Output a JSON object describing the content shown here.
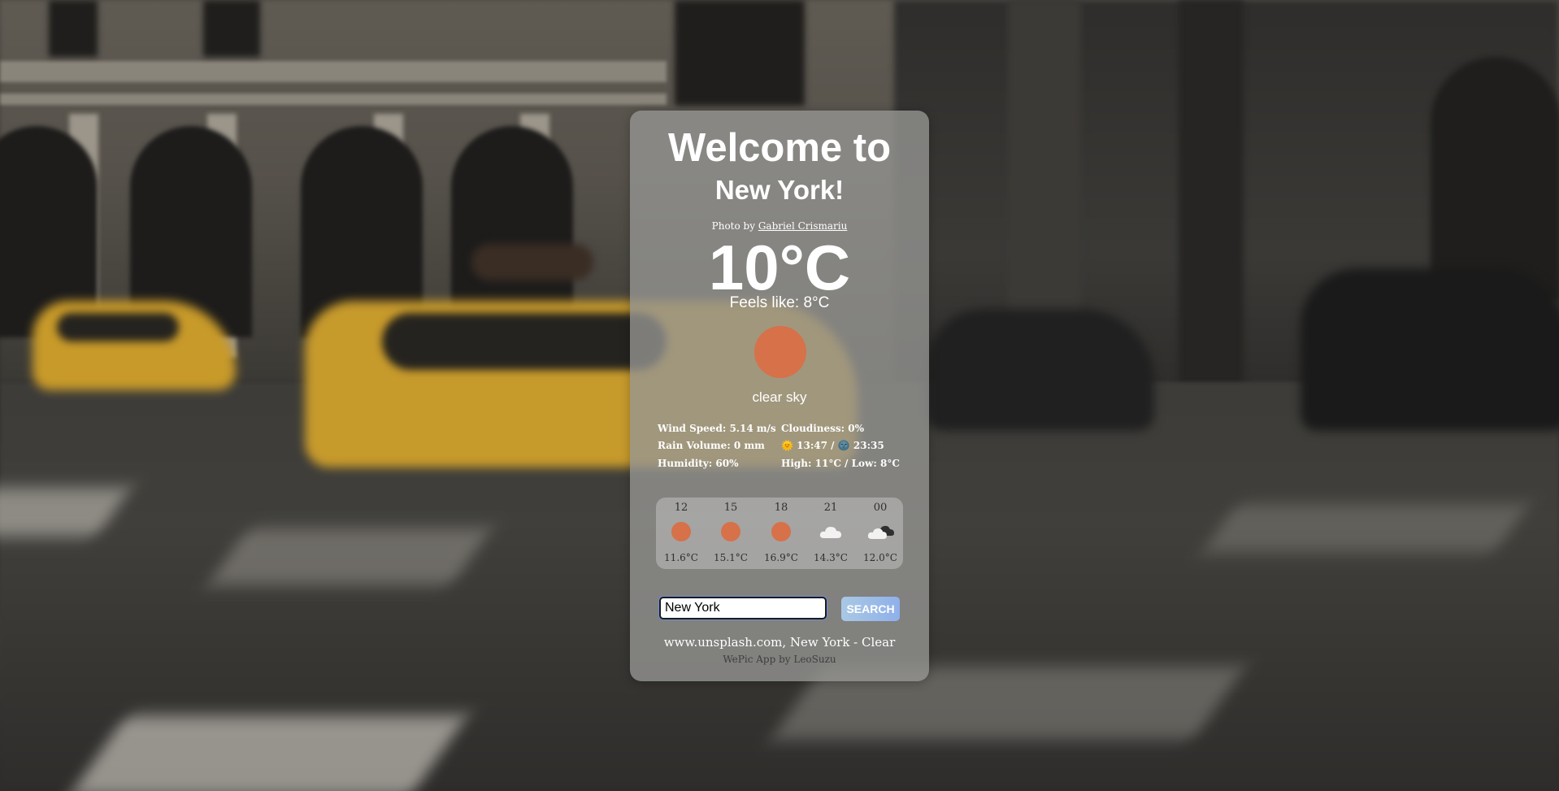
{
  "header": {
    "welcome": "Welcome to",
    "city": "New York!"
  },
  "photo": {
    "prefix": "Photo by",
    "author": "Gabriel Crismariu"
  },
  "current": {
    "temperature": "10°C",
    "feels_like": "Feels like: 8°C",
    "description": "clear sky",
    "icon": "sun-icon"
  },
  "details": {
    "wind": "Wind Speed: 5.14 m/s",
    "rain": "Rain Volume: 0 mm",
    "humidity": "Humidity: 60%",
    "cloudiness": "Cloudiness: 0%",
    "sunrise_icon": "🌞",
    "sunrise": "13:47",
    "separator": "/",
    "sunset_icon": "🌚",
    "sunset": "23:35",
    "high_low": "High: 11°C / Low: 8°C"
  },
  "forecast": [
    {
      "hour": "12",
      "temp": "11.6°C",
      "icon": "sun-icon"
    },
    {
      "hour": "15",
      "temp": "15.1°C",
      "icon": "sun-icon"
    },
    {
      "hour": "18",
      "temp": "16.9°C",
      "icon": "sun-icon"
    },
    {
      "hour": "21",
      "temp": "14.3°C",
      "icon": "cloud-icon"
    },
    {
      "hour": "00",
      "temp": "12.0°C",
      "icon": "night-clouds-icon"
    }
  ],
  "search": {
    "value": "New York",
    "button_label": "SEARCH"
  },
  "footer": {
    "source": "www.unsplash.com, New York - Clear",
    "credit": "WePic App by LeoSuzu"
  },
  "colors": {
    "sun": "#d6714a",
    "card": "rgba(150,150,148,0.78)",
    "button_gradient_start": "#a9c8e4",
    "button_gradient_end": "#8fb0ea"
  }
}
